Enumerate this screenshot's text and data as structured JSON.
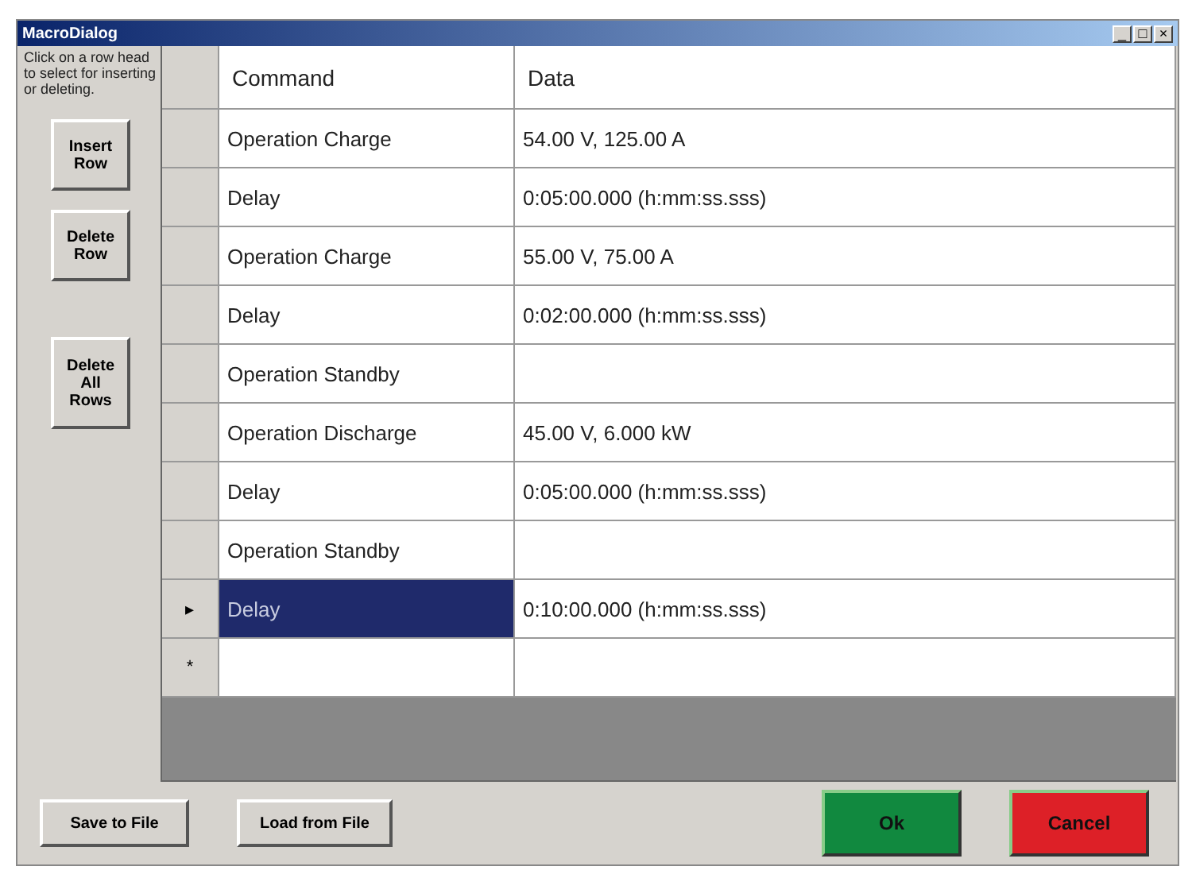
{
  "window": {
    "title": "MacroDialog",
    "controls": [
      "_",
      "□",
      "×"
    ]
  },
  "sidebar": {
    "hint": "Click on a row head to select for inserting or deleting.",
    "buttons": [
      "Insert Row",
      "Delete Row",
      "Delete All Rows"
    ]
  },
  "table": {
    "columns": [
      "Command",
      "Data"
    ],
    "rows": [
      {
        "marker": "",
        "selected": false,
        "cells": [
          "Operation Charge",
          "54.00 V, 125.00 A"
        ]
      },
      {
        "marker": "",
        "selected": false,
        "cells": [
          "Delay",
          "0:05:00.000 (h:mm:ss.sss)"
        ]
      },
      {
        "marker": "",
        "selected": false,
        "cells": [
          "Operation Charge",
          "55.00 V, 75.00 A"
        ]
      },
      {
        "marker": "",
        "selected": false,
        "cells": [
          "Delay",
          "0:02:00.000 (h:mm:ss.sss)"
        ]
      },
      {
        "marker": "",
        "selected": false,
        "cells": [
          "Operation Standby",
          ""
        ]
      },
      {
        "marker": "",
        "selected": false,
        "cells": [
          "Operation Discharge",
          "45.00 V, 6.000 kW"
        ]
      },
      {
        "marker": "",
        "selected": false,
        "cells": [
          "Delay",
          "0:05:00.000 (h:mm:ss.sss)"
        ]
      },
      {
        "marker": "",
        "selected": false,
        "cells": [
          "Operation Standby",
          ""
        ]
      },
      {
        "marker": "▸",
        "selected": true,
        "cells": [
          "Delay",
          "0:10:00.000 (h:mm:ss.sss)"
        ]
      },
      {
        "marker": "*",
        "selected": false,
        "cells": [
          "",
          ""
        ]
      }
    ]
  },
  "footer": {
    "file_buttons": [
      "Save to File",
      "Load from File"
    ],
    "ok": "Ok",
    "cancel": "Cancel"
  }
}
